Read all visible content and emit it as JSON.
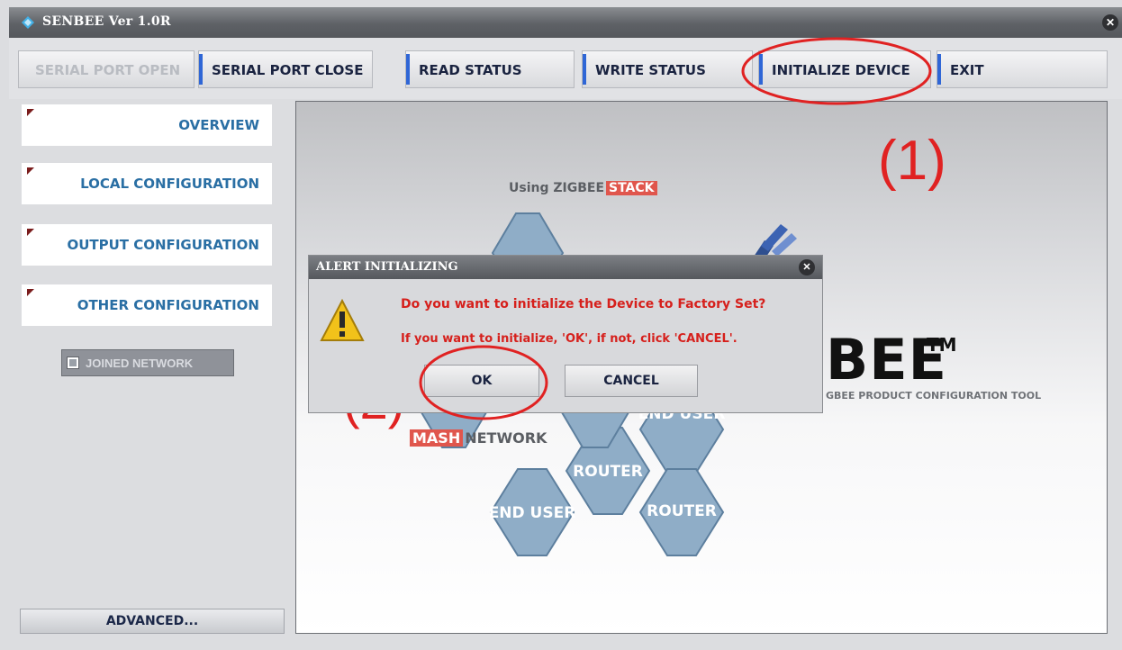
{
  "window": {
    "title": "SENBEE Ver 1.0R",
    "close_glyph": "✕"
  },
  "toolbar": {
    "serial_open": "SERIAL PORT OPEN",
    "serial_close": "SERIAL PORT CLOSE",
    "read_status": "READ STATUS",
    "write_status": "WRITE STATUS",
    "initialize_device": "INITIALIZE DEVICE",
    "exit": "EXIT"
  },
  "sidebar": {
    "items": [
      {
        "label": "OVERVIEW"
      },
      {
        "label": "LOCAL CONFIGURATION"
      },
      {
        "label": "OUTPUT CONFIGURATION"
      },
      {
        "label": "OTHER CONFIGURATION"
      }
    ],
    "joined_network": "JOINED NETWORK",
    "advanced": "ADVANCED..."
  },
  "content": {
    "using": "Using ZIGBEE",
    "stack": "STACK",
    "mash": "MASH",
    "network": "NETWORK",
    "hex_labels": [
      "END USER",
      "ROUTER",
      "END USER",
      "ROUTER"
    ],
    "big_title": "BEE",
    "trademark": "TM",
    "subtitle": "GBEE PRODUCT CONFIGURATION TOOL"
  },
  "annotations": {
    "step1": "(1)",
    "step2": "(2)"
  },
  "dialog": {
    "title": "ALERT INITIALIZING",
    "close_glyph": "✕",
    "message1": "Do you want to initialize the Device to Factory Set?",
    "message2": "If you want to initialize, 'OK', if not, click 'CANCEL'.",
    "ok": "OK",
    "cancel": "CANCEL"
  },
  "colors": {
    "accent_blue": "#2f66d6",
    "nav_text": "#2a6fa4",
    "alert_red": "#d6201c",
    "annotation_red": "#e02222",
    "hex_fill": "#8fadc7"
  }
}
